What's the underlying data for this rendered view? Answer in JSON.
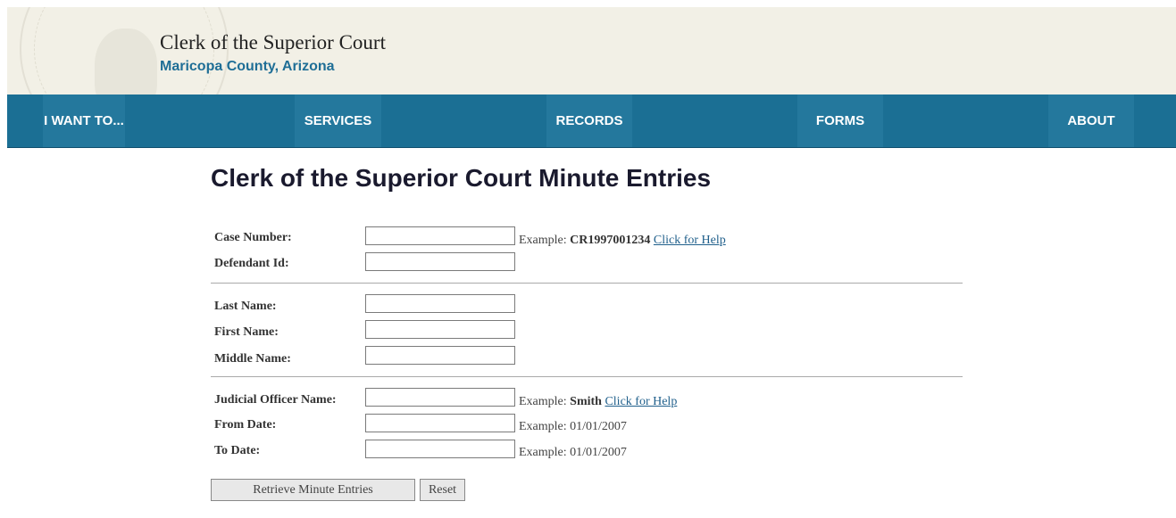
{
  "header": {
    "title": "Clerk of the Superior Court",
    "subtitle": "Maricopa County, Arizona"
  },
  "nav": {
    "items": [
      {
        "label": "I WANT TO..."
      },
      {
        "label": "SERVICES"
      },
      {
        "label": "RECORDS"
      },
      {
        "label": "FORMS"
      },
      {
        "label": "ABOUT"
      }
    ]
  },
  "page_title": "Clerk of the Superior Court Minute Entries",
  "form": {
    "case_number": {
      "label": "Case Number:",
      "value": "",
      "example_prefix": "Example: ",
      "example_value": "CR1997001234",
      "help_link": "Click for Help"
    },
    "defendant_id": {
      "label": "Defendant Id:",
      "value": ""
    },
    "last_name": {
      "label": "Last Name:",
      "value": ""
    },
    "first_name": {
      "label": "First Name:",
      "value": ""
    },
    "middle_name": {
      "label": "Middle Name:",
      "value": ""
    },
    "judicial_officer": {
      "label": "Judicial Officer Name:",
      "value": "",
      "example_prefix": "Example: ",
      "example_value": "Smith",
      "help_link": "Click for Help"
    },
    "from_date": {
      "label": "From Date:",
      "value": "",
      "example": "Example: 01/01/2007"
    },
    "to_date": {
      "label": "To Date:",
      "value": "",
      "example": "Example: 01/01/2007"
    }
  },
  "buttons": {
    "retrieve": "Retrieve Minute Entries",
    "reset": "Reset"
  },
  "colors": {
    "header_bg": "#f2f0e6",
    "nav_bg": "#1b6f94",
    "nav_item_bg": "#24789d",
    "subtitle": "#1f6e96",
    "link": "#1f5f8b"
  }
}
